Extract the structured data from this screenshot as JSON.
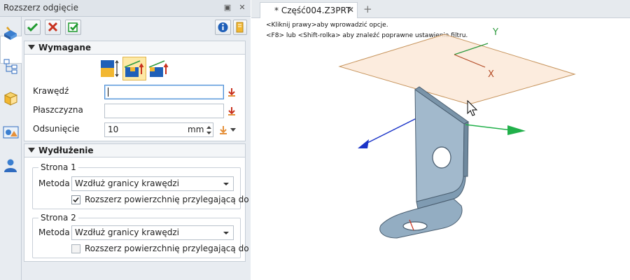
{
  "panel": {
    "title": "Rozszerz odgięcie",
    "sections": {
      "required": {
        "title": "Wymagane",
        "rows": {
          "edge": {
            "label": "Krawędź",
            "value": ""
          },
          "plane": {
            "label": "Płaszczyzna",
            "value": ""
          },
          "offset": {
            "label": "Odsunięcie",
            "value": "10",
            "unit": "mm"
          }
        }
      },
      "extension": {
        "title": "Wydłużenie",
        "side1": {
          "title": "Strona 1",
          "method_label": "Metoda",
          "method_value": "Wzdłuż granicy krawędzi",
          "checkbox_label": "Rozszerz powierzchnię przylegającą do kr",
          "checked": true
        },
        "side2": {
          "title": "Strona 2",
          "method_label": "Metoda",
          "method_value": "Wzdłuż granicy krawędzi",
          "checkbox_label": "Rozszerz powierzchnię przylegającą do kr",
          "checked": false
        }
      }
    }
  },
  "viewport": {
    "tab_label": "* Część004.Z3PRT",
    "hints": [
      "<Kliknij prawy>aby wprowadzić opcje.",
      "<F8> lub <Shift-rolka> aby znaleźć poprawne ustawienia filtru."
    ],
    "axes": {
      "y": "Y",
      "x": "X"
    }
  },
  "icons": {
    "ok": "checkmark-icon",
    "cancel": "x-cancel-icon",
    "apply": "apply-check-icon",
    "info": "info-icon",
    "help": "help-book-icon",
    "pick": "pick-arrow-icon"
  },
  "colors": {
    "accent": "#4d8fd6",
    "selected_option": "#fde9a6",
    "plane_fill": "#fbe9d8",
    "plane_edge": "#c7955e",
    "part": "#9fb6c8",
    "axis_x": "#21b04a",
    "axis_y": "#1b34c8"
  }
}
